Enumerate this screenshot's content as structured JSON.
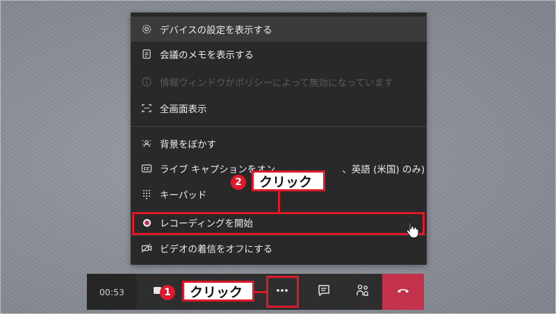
{
  "menu": {
    "items": [
      {
        "label": "デバイスの設定を表示する",
        "icon": "gear-icon"
      },
      {
        "label": "会議のメモを表示する",
        "icon": "notes-icon"
      },
      {
        "label": "情報ウィンドウがポリシーによって無効になっています",
        "icon": "info-icon"
      },
      {
        "label": "全画面表示",
        "icon": "fullscreen-icon"
      },
      {
        "label": "背景をぼかす",
        "icon": "blur-icon"
      },
      {
        "label": "ライブ キャプションをオン",
        "label_tail": "、英語 (米国) のみ)",
        "icon": "cc-icon"
      },
      {
        "label": "キーパッド",
        "icon": "keypad-icon"
      },
      {
        "label": "レコーディングを開始",
        "icon": "record-icon"
      },
      {
        "label": "ビデオの着信をオフにする",
        "icon": "video-off-icon"
      }
    ]
  },
  "toolbar": {
    "timer": "00:53",
    "buttons": [
      "camera-icon",
      "more-options-icon",
      "chat-icon",
      "participants-icon",
      "hang-up-icon"
    ]
  },
  "annotations": {
    "callout1": {
      "number": "1",
      "text": "クリック"
    },
    "callout2": {
      "number": "2",
      "text": "クリック"
    }
  },
  "colors": {
    "menu_bg": "#292929",
    "accent_red": "#e0192a",
    "hangup": "#c4314b",
    "record_dot": "#c4314b"
  }
}
